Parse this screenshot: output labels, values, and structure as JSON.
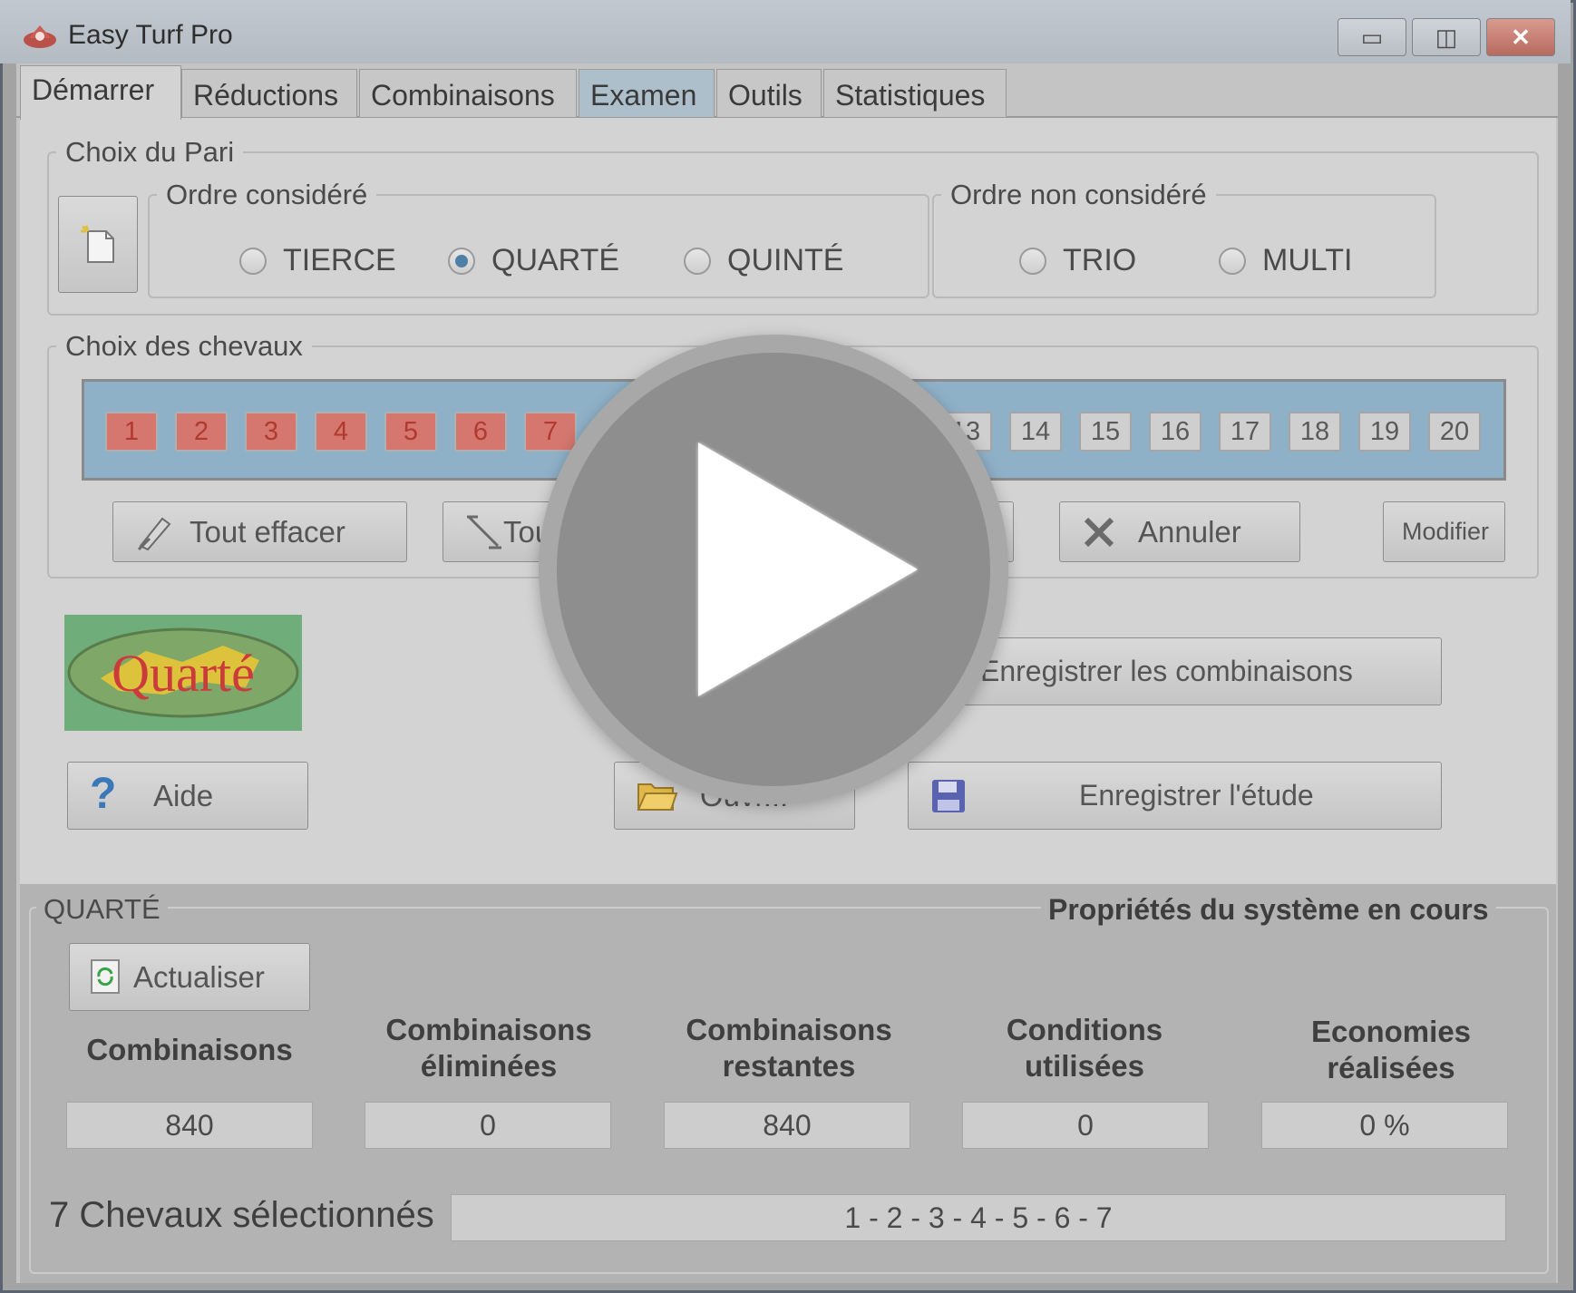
{
  "window": {
    "title": "Easy Turf Pro",
    "controls": {
      "minimize": "▭",
      "maximize": "◫",
      "close": "✕"
    }
  },
  "tabs": [
    {
      "label": "Démarrer",
      "active": true
    },
    {
      "label": "Réductions"
    },
    {
      "label": "Combinaisons"
    },
    {
      "label": "Examen",
      "highlighted": true
    },
    {
      "label": "Outils"
    },
    {
      "label": "Statistiques"
    }
  ],
  "bet_choice": {
    "legend": "Choix du Pari",
    "ordered": {
      "legend": "Ordre considéré",
      "options": [
        {
          "label": "TIERCE",
          "checked": false
        },
        {
          "label": "QUARTÉ",
          "checked": true
        },
        {
          "label": "QUINTÉ",
          "checked": false
        }
      ]
    },
    "unordered": {
      "legend": "Ordre non considéré",
      "options": [
        {
          "label": "TRIO",
          "checked": false
        },
        {
          "label": "MULTI",
          "checked": false
        }
      ]
    }
  },
  "horses": {
    "legend": "Choix des chevaux",
    "visible_left": [
      "1",
      "2",
      "3",
      "4",
      "5",
      "6",
      "7"
    ],
    "visible_right": [
      "13",
      "14",
      "15",
      "16",
      "17",
      "18",
      "19",
      "20"
    ],
    "selected": [
      "1",
      "2",
      "3",
      "4",
      "5",
      "6",
      "7"
    ]
  },
  "buttons": {
    "tout_effacer": "Tout effacer",
    "tout_partial": "Tout",
    "annuler": "Annuler",
    "modifier": "Modifier",
    "enregistrer_combinaisons": "Enregistrer les combinaisons",
    "aide": "Aide",
    "ouvrir_partial": "Ouvr...",
    "enregistrer_etude": "Enregistrer l'étude",
    "actualiser": "Actualiser"
  },
  "logo_text": "Quarté",
  "properties": {
    "group_label": "QUARTÉ",
    "title": "Propriétés du système en cours",
    "stats": [
      {
        "header_line1": "Combinaisons",
        "header_line2": "",
        "value": "840"
      },
      {
        "header_line1": "Combinaisons",
        "header_line2": "éliminées",
        "value": "0"
      },
      {
        "header_line1": "Combinaisons",
        "header_line2": "restantes",
        "value": "840"
      },
      {
        "header_line1": "Conditions",
        "header_line2": "utilisées",
        "value": "0"
      },
      {
        "header_line1": "Economies",
        "header_line2": "réalisées",
        "value": "0 %"
      }
    ],
    "selected_label": "7 Chevaux sélectionnés",
    "selected_value": "1 - 2 - 3 - 4 - 5 - 6 - 7"
  },
  "colors": {
    "selected_horse": "#d5776e",
    "horse_strip": "#8fb1c8",
    "logo_bg": "#6fae7a",
    "logo_text": "#cc3b3b",
    "logo_shape": "#e3c43a"
  },
  "icons": {
    "play": "play-icon",
    "new": "new-document-icon",
    "erase": "eraser-icon",
    "cancel": "x-icon",
    "help": "question-icon",
    "open": "folder-open-icon",
    "save": "floppy-disk-icon",
    "refresh": "refresh-icon"
  }
}
